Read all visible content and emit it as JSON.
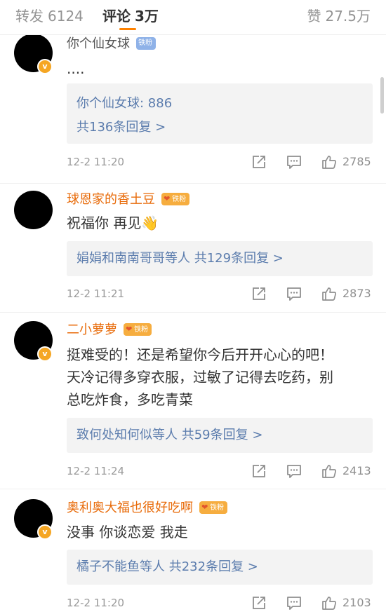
{
  "tabs": {
    "repost_label": "转发",
    "repost_count": "6124",
    "comment_label": "评论",
    "comment_count": "3万",
    "like_label": "赞",
    "like_count": "27.5万"
  },
  "colors": {
    "accent": "#ff8200",
    "username": "#e86b0a",
    "reply_link": "#5b7cad",
    "reply_bg": "#f3f3f3"
  },
  "comments": [
    {
      "username": "你个仙女球",
      "fan_badge": "铁粉",
      "verified_badge": true,
      "text": "....",
      "reply_lines": [
        "你个仙女球: 886",
        "共136条回复 >"
      ],
      "time": "12-2 11:20",
      "likes": "2785"
    },
    {
      "username": "球恩家的香土豆",
      "fan_badge": "铁粉",
      "verified_badge": false,
      "text": "祝福你 再见👋",
      "reply_lines": [
        "娟娟和南南哥哥等人  共129条回复 >"
      ],
      "time": "12-2 11:21",
      "likes": "2873"
    },
    {
      "username": "二小萝萝",
      "fan_badge": "铁粉",
      "verified_badge": true,
      "text": "挺难受的！还是希望你今后开开心心的吧！\n天冷记得多穿衣服，过敏了记得去吃药，别\n总吃炸食，多吃青菜",
      "reply_lines": [
        "致何处知何似等人  共59条回复 >"
      ],
      "time": "12-2 11:24",
      "likes": "2413"
    },
    {
      "username": "奥利奥大福也很好吃啊",
      "fan_badge": "铁粉",
      "verified_badge": true,
      "text": "没事 你谈恋爱 我走",
      "reply_lines": [
        "橘子不能鱼等人  共232条回复 >"
      ],
      "time": "12-2 11:20",
      "likes": "2103"
    }
  ],
  "icons": {
    "share": "share-icon",
    "comment": "comment-icon",
    "like": "thumbs-up-icon",
    "verified": "verified-v-icon",
    "fan_heart": "heart-icon"
  }
}
